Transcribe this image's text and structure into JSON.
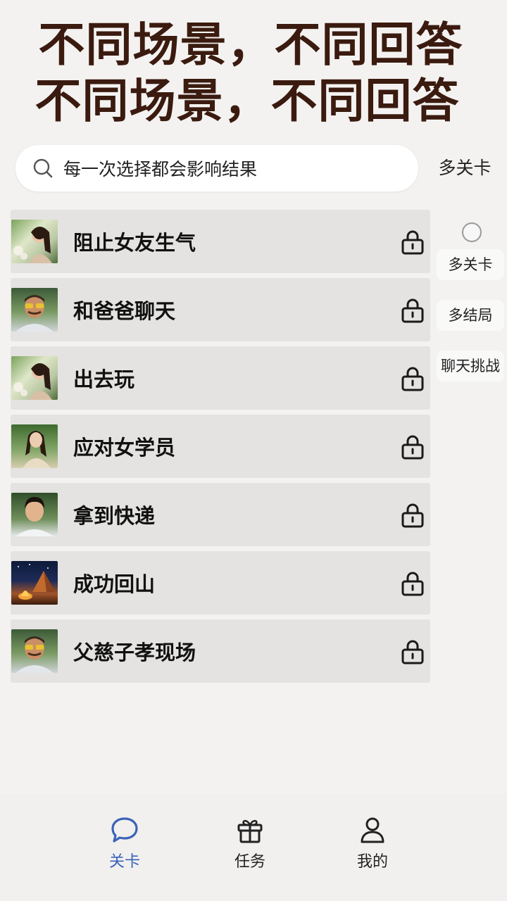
{
  "banner": {
    "line1": "不同场景，不同回答",
    "line2": "不同场景，不同回答"
  },
  "search": {
    "placeholder": "每一次选择都会影响结果",
    "icon": "search-icon"
  },
  "top_filter": {
    "label": "多关卡"
  },
  "levels": [
    {
      "title": "阻止女友生气",
      "avatar": "woman-flowers",
      "locked": true
    },
    {
      "title": "和爸爸聊天",
      "avatar": "older-man-glasses",
      "locked": true
    },
    {
      "title": "出去玩",
      "avatar": "woman-flowers",
      "locked": true
    },
    {
      "title": "应对女学员",
      "avatar": "woman-forest",
      "locked": true
    },
    {
      "title": "拿到快递",
      "avatar": "young-man",
      "locked": true
    },
    {
      "title": "成功回山",
      "avatar": "campfire-night",
      "locked": true
    },
    {
      "title": "父慈子孝现场",
      "avatar": "older-man-glasses",
      "locked": true
    }
  ],
  "side_filters": [
    {
      "label": "多关卡"
    },
    {
      "label": "多结局"
    },
    {
      "label": "聊天挑战"
    }
  ],
  "tabbar": {
    "items": [
      {
        "label": "关卡",
        "icon": "chat-bubble-icon",
        "active": true
      },
      {
        "label": "任务",
        "icon": "gift-icon",
        "active": false
      },
      {
        "label": "我的",
        "icon": "person-icon",
        "active": false
      }
    ],
    "active_color": "#3a63b8"
  },
  "colors": {
    "banner_text": "#3b1b0f",
    "row_bg": "#e4e3e1",
    "page_bg": "#f3f2f1"
  }
}
